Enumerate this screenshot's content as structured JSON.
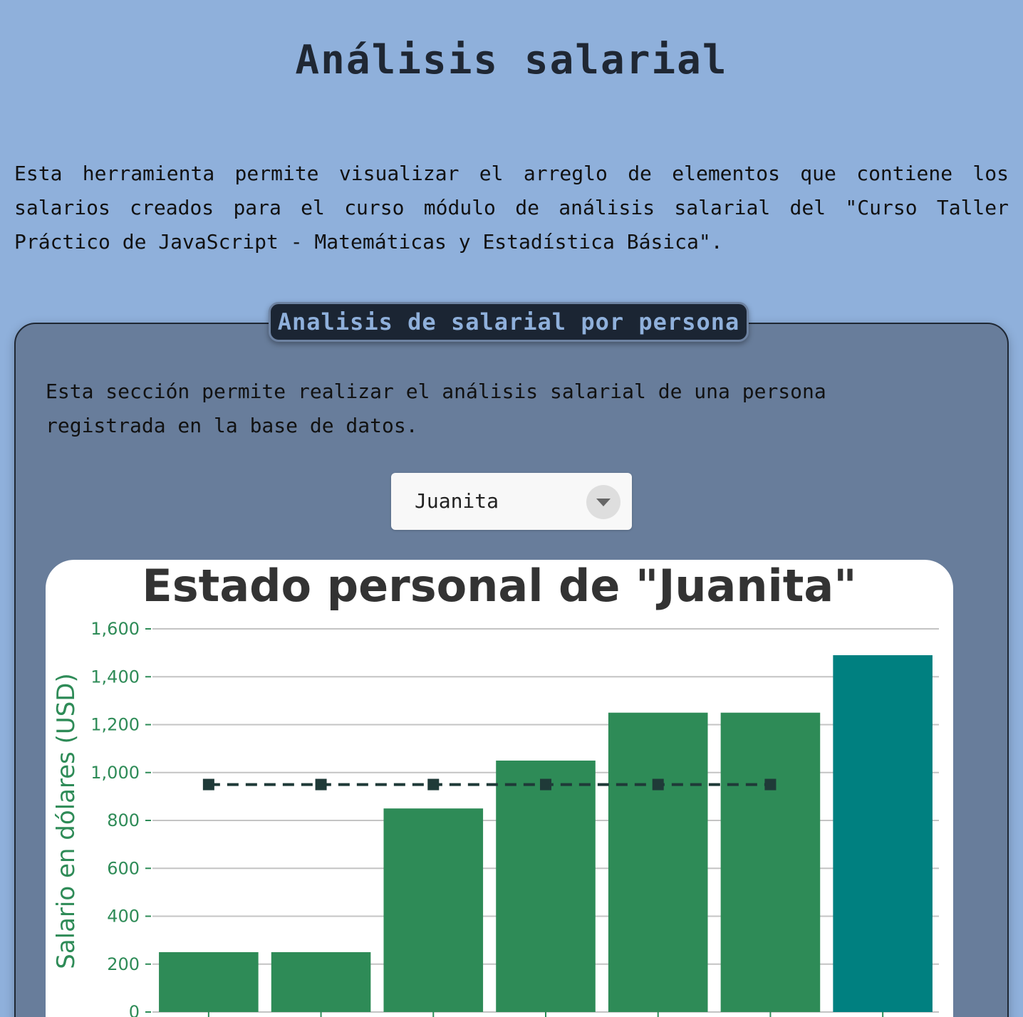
{
  "page": {
    "title": "Análisis salarial",
    "intro": "Esta herramienta permite visualizar el arreglo de elementos que contiene los salarios creados para el curso módulo de análisis salarial del \"Curso Taller Práctico de JavaScript - Matemáticas y Estadística Básica\"."
  },
  "section": {
    "legend": "Analisis de salarial por persona",
    "description": "Esta sección permite realizar el análisis salarial de una persona registrada en la base de datos.",
    "select": {
      "value": "Juanita",
      "arrow_icon": "chevron-down-icon"
    }
  },
  "colors": {
    "background": "#8fb0db",
    "card": "#687d9b",
    "bar": "#2e8b57",
    "bar_highlight": "#008080",
    "line": "#1f3a38"
  },
  "chart_data": {
    "type": "bar",
    "title": "Estado personal de \"Juanita\"",
    "ylabel": "Salario en dólares (USD)",
    "ylim": [
      0,
      1600
    ],
    "yticks": [
      0,
      200,
      400,
      600,
      800,
      1000,
      1200,
      1400,
      1600
    ],
    "ytick_labels": [
      "0",
      "200",
      "400",
      "600",
      "800",
      "1,000",
      "1,200",
      "1,400",
      "1,600"
    ],
    "grid": true,
    "series": [
      {
        "type": "bar",
        "values": [
          250,
          250,
          850,
          1050,
          1250,
          1250,
          1490
        ],
        "colors": [
          "#2e8b57",
          "#2e8b57",
          "#2e8b57",
          "#2e8b57",
          "#2e8b57",
          "#2e8b57",
          "#008080"
        ]
      },
      {
        "type": "line",
        "style": "dashed",
        "marker": "square",
        "values": [
          950,
          950,
          950,
          950,
          950,
          950
        ]
      }
    ]
  }
}
